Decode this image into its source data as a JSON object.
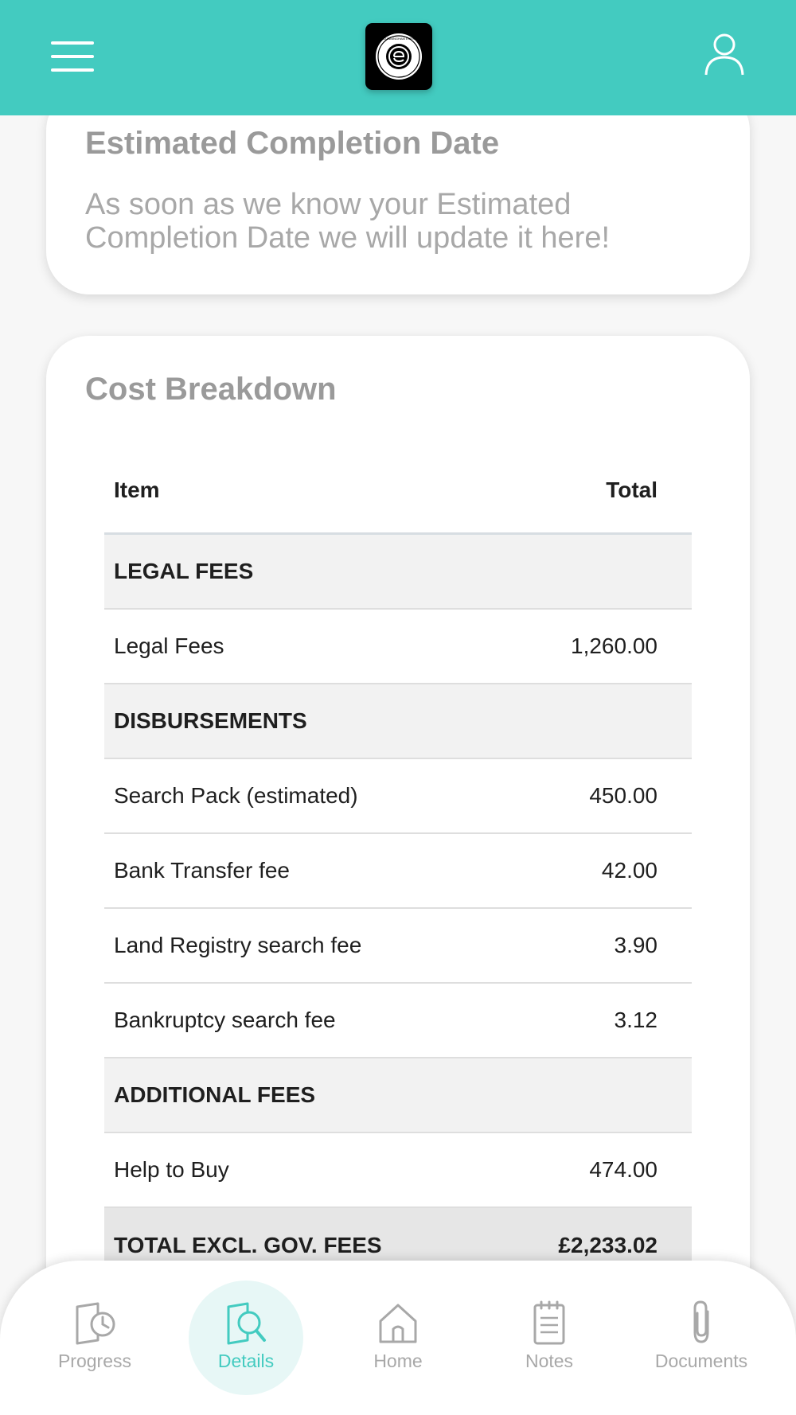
{
  "header": {
    "logo_text": "CUNNINGHAM EVES SOLICITORS"
  },
  "completion": {
    "title": "Estimated Completion Date",
    "message": "As soon as we know your Estimated Completion Date we will update it here!"
  },
  "cost_breakdown": {
    "title": "Cost Breakdown",
    "col_item": "Item",
    "col_total": "Total",
    "rows": [
      {
        "type": "section",
        "label": "LEGAL FEES",
        "value": ""
      },
      {
        "type": "item",
        "label": "Legal Fees",
        "value": "1,260.00"
      },
      {
        "type": "section",
        "label": "DISBURSEMENTS",
        "value": ""
      },
      {
        "type": "item",
        "label": "Search Pack (estimated)",
        "value": "450.00"
      },
      {
        "type": "item",
        "label": "Bank Transfer fee",
        "value": "42.00"
      },
      {
        "type": "item",
        "label": "Land Registry search fee",
        "value": "3.90"
      },
      {
        "type": "item",
        "label": "Bankruptcy search fee",
        "value": "3.12"
      },
      {
        "type": "section",
        "label": "ADDITIONAL FEES",
        "value": ""
      },
      {
        "type": "item",
        "label": "Help to Buy",
        "value": "474.00"
      },
      {
        "type": "total",
        "label": "TOTAL EXCL. GOV. FEES",
        "value": "£2,233.02"
      }
    ]
  },
  "nav": {
    "items": [
      {
        "label": "Progress",
        "icon": "progress-clock-icon"
      },
      {
        "label": "Details",
        "icon": "document-search-icon",
        "active": true
      },
      {
        "label": "Home",
        "icon": "home-icon"
      },
      {
        "label": "Notes",
        "icon": "notes-icon"
      },
      {
        "label": "Documents",
        "icon": "paperclip-icon"
      }
    ]
  },
  "colors": {
    "brand_teal": "#43cbc0",
    "active_tab_bg": "#e7f7f6",
    "muted_text": "#a8a8a8"
  }
}
